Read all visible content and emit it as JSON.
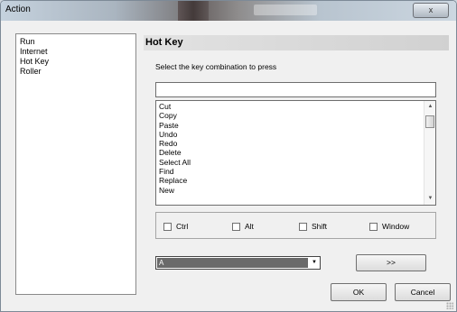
{
  "window": {
    "title": "Action",
    "close_glyph": "x"
  },
  "sidebar": {
    "items": [
      {
        "label": "Run"
      },
      {
        "label": "Internet"
      },
      {
        "label": "Hot Key"
      },
      {
        "label": "Roller"
      }
    ]
  },
  "panel": {
    "title": "Hot Key",
    "prompt": "Select the key combination to press",
    "key_input_value": "",
    "key_list": [
      "Cut",
      "Copy",
      "Paste",
      "Undo",
      "Redo",
      "Delete",
      "Select All",
      "Find",
      "Replace",
      "New"
    ],
    "modifiers": [
      {
        "label": "Ctrl",
        "checked": false
      },
      {
        "label": "Alt",
        "checked": false
      },
      {
        "label": "Shift",
        "checked": false
      },
      {
        "label": "Window",
        "checked": false
      }
    ],
    "key_select_value": "A",
    "assign_label": ">>"
  },
  "footer": {
    "ok_label": "OK",
    "cancel_label": "Cancel"
  },
  "icons": {
    "scroll_up": "up-arrow-icon",
    "scroll_down": "down-arrow-icon",
    "dropdown": "chevron-down-icon",
    "close": "close-icon"
  }
}
